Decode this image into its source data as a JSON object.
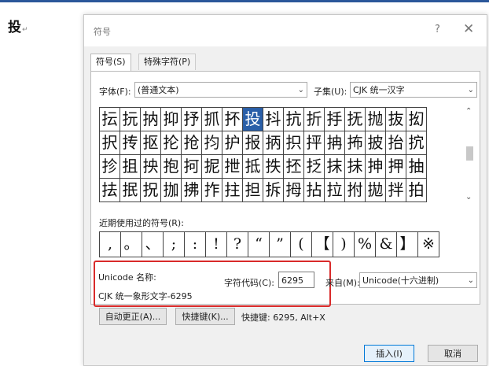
{
  "document": {
    "char": "投"
  },
  "dialog": {
    "title": "符号",
    "help_glyph": "?",
    "close_glyph": "✕",
    "tabs": [
      {
        "label": "符号(S)",
        "active": true
      },
      {
        "label": "特殊字符(P)",
        "active": false
      }
    ],
    "font_label": "字体(F):",
    "font_value": "(普通文本)",
    "subset_label": "子集(U):",
    "subset_value": "CJK 统一汉字",
    "symbols": [
      [
        "抎",
        "抏",
        "抐",
        "抑",
        "抒",
        "抓",
        "抔",
        "投",
        "抖",
        "抗",
        "折",
        "抙",
        "抚",
        "抛",
        "抜",
        "抝"
      ],
      [
        "択",
        "抟",
        "抠",
        "抡",
        "抢",
        "抣",
        "护",
        "报",
        "抦",
        "抧",
        "抨",
        "抩",
        "抪",
        "披",
        "抬",
        "抭"
      ],
      [
        "抮",
        "抯",
        "抰",
        "抱",
        "抲",
        "抳",
        "抴",
        "抵",
        "抶",
        "抷",
        "抸",
        "抹",
        "抺",
        "抻",
        "押",
        "抽"
      ],
      [
        "抾",
        "抿",
        "拀",
        "拁",
        "拂",
        "拃",
        "拄",
        "担",
        "拆",
        "拇",
        "拈",
        "拉",
        "拊",
        "拋",
        "拌",
        "拍"
      ]
    ],
    "selected_symbol": "投",
    "recent_label": "近期使用过的符号(R):",
    "recent_symbols": [
      ",",
      "。",
      "、",
      ";",
      ":",
      "!",
      "?",
      "“",
      "”",
      "(",
      "【",
      ")",
      "%",
      "&",
      "】",
      "※"
    ],
    "unicode_name_label": "Unicode 名称:",
    "unicode_name_value": "CJK 统一象形文字-6295",
    "char_code_label": "字符代码(C):",
    "char_code_value": "6295",
    "from_label": "来自(M):",
    "from_value": "Unicode(十六进制)",
    "autocorrect_button": "自动更正(A)...",
    "shortcut_key_button": "快捷键(K)...",
    "shortcut_text": "快捷键: 6295, Alt+X",
    "insert_button": "插入(I)",
    "cancel_button": "取消",
    "accent_color": "#2a5fa8",
    "highlight_color": "#d92a2a"
  }
}
